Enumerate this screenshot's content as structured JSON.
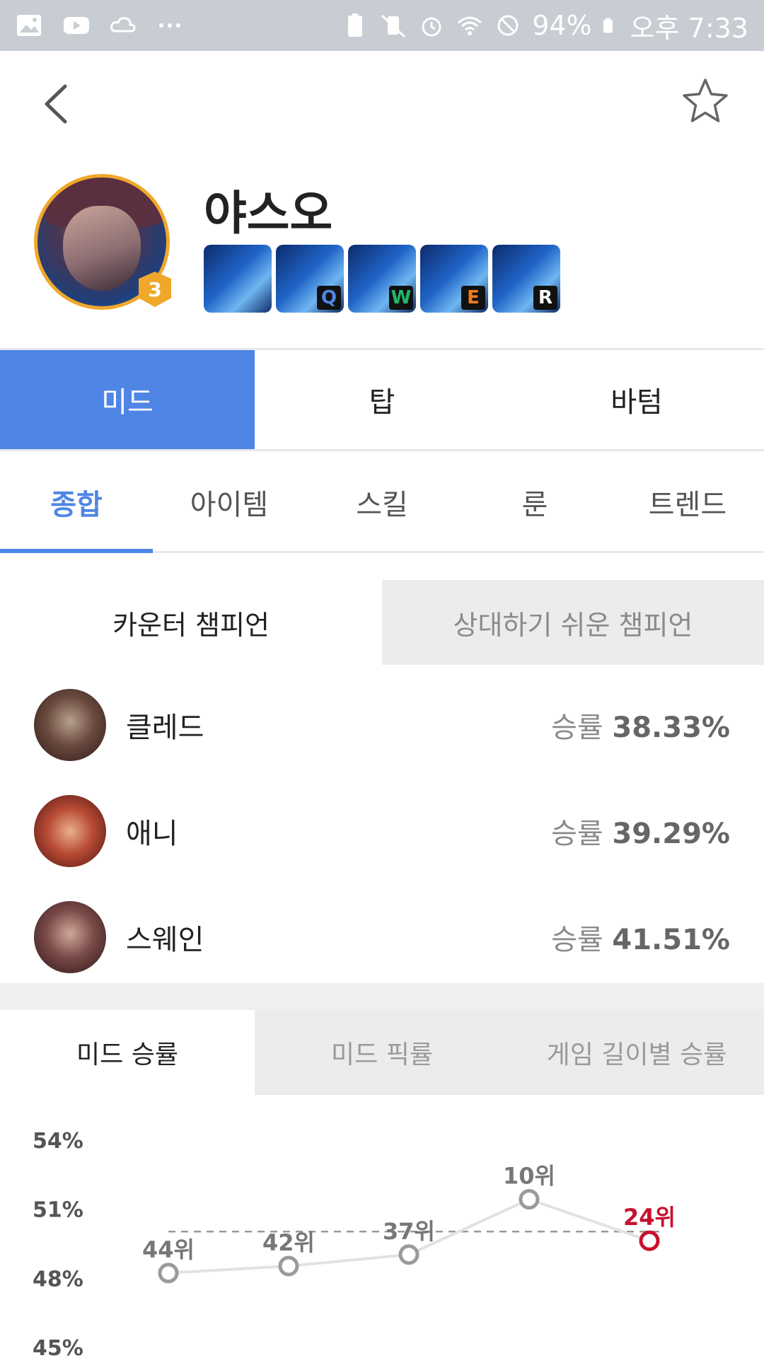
{
  "status_bar": {
    "battery": "94%",
    "time": "오후 7:33",
    "icons": [
      "image-icon",
      "youtube-icon",
      "cloud-icon",
      "more-icon",
      "battery-saver-icon",
      "vibrate-icon",
      "alarm-icon",
      "wifi-icon",
      "blocked-icon",
      "battery-icon"
    ]
  },
  "appbar": {
    "back_icon": "chevron-left-icon",
    "favorite_icon": "star-outline-icon"
  },
  "champion": {
    "name": "야스오",
    "level": "3",
    "skills": [
      {
        "key": "",
        "icon": "passive-skill-icon"
      },
      {
        "key": "Q",
        "key_color": "#4f86e6",
        "icon": "q-skill-icon"
      },
      {
        "key": "W",
        "key_color": "#20b66a",
        "icon": "w-skill-icon"
      },
      {
        "key": "E",
        "key_color": "#f07a1a",
        "icon": "e-skill-icon"
      },
      {
        "key": "R",
        "key_color": "#ffffff",
        "icon": "r-skill-icon"
      }
    ]
  },
  "lane_tabs": [
    {
      "label": "미드",
      "active": true
    },
    {
      "label": "탑",
      "active": false
    },
    {
      "label": "바텀",
      "active": false
    }
  ],
  "sub_tabs": [
    {
      "label": "종합",
      "active": true
    },
    {
      "label": "아이템",
      "active": false
    },
    {
      "label": "스킬",
      "active": false
    },
    {
      "label": "룬",
      "active": false
    },
    {
      "label": "트렌드",
      "active": false
    }
  ],
  "counter_toggle": {
    "active": "카운터 챔피언",
    "inactive": "상대하기 쉬운 챔피언"
  },
  "counters": [
    {
      "name": "클레드",
      "rate_label": "승률",
      "rate": "38.33%"
    },
    {
      "name": "애니",
      "rate_label": "승률",
      "rate": "39.29%"
    },
    {
      "name": "스웨인",
      "rate_label": "승률",
      "rate": "41.51%"
    }
  ],
  "chart_tabs": [
    {
      "label": "미드 승률",
      "active": true
    },
    {
      "label": "미드 픽률",
      "active": false
    },
    {
      "label": "게임 길이별 승률",
      "active": false
    }
  ],
  "colors": {
    "accent": "#4f86e6",
    "highlight": "#c8102e",
    "point": "#9a9a9a"
  },
  "chart_data": {
    "type": "line",
    "title": "",
    "xlabel": "",
    "ylabel": "",
    "ylim": [
      45,
      54
    ],
    "yticks": [
      "54%",
      "51%",
      "48%",
      "45%"
    ],
    "ytick_values": [
      54,
      51,
      48,
      45
    ],
    "average": 50.0,
    "points": [
      {
        "value": 48.2,
        "label": "44위",
        "highlight": false
      },
      {
        "value": 48.5,
        "label": "42위",
        "highlight": false
      },
      {
        "value": 49.0,
        "label": "37위",
        "highlight": false
      },
      {
        "value": 51.4,
        "label": "10위",
        "highlight": false
      },
      {
        "value": 49.6,
        "label": "24위",
        "highlight": true
      }
    ]
  }
}
